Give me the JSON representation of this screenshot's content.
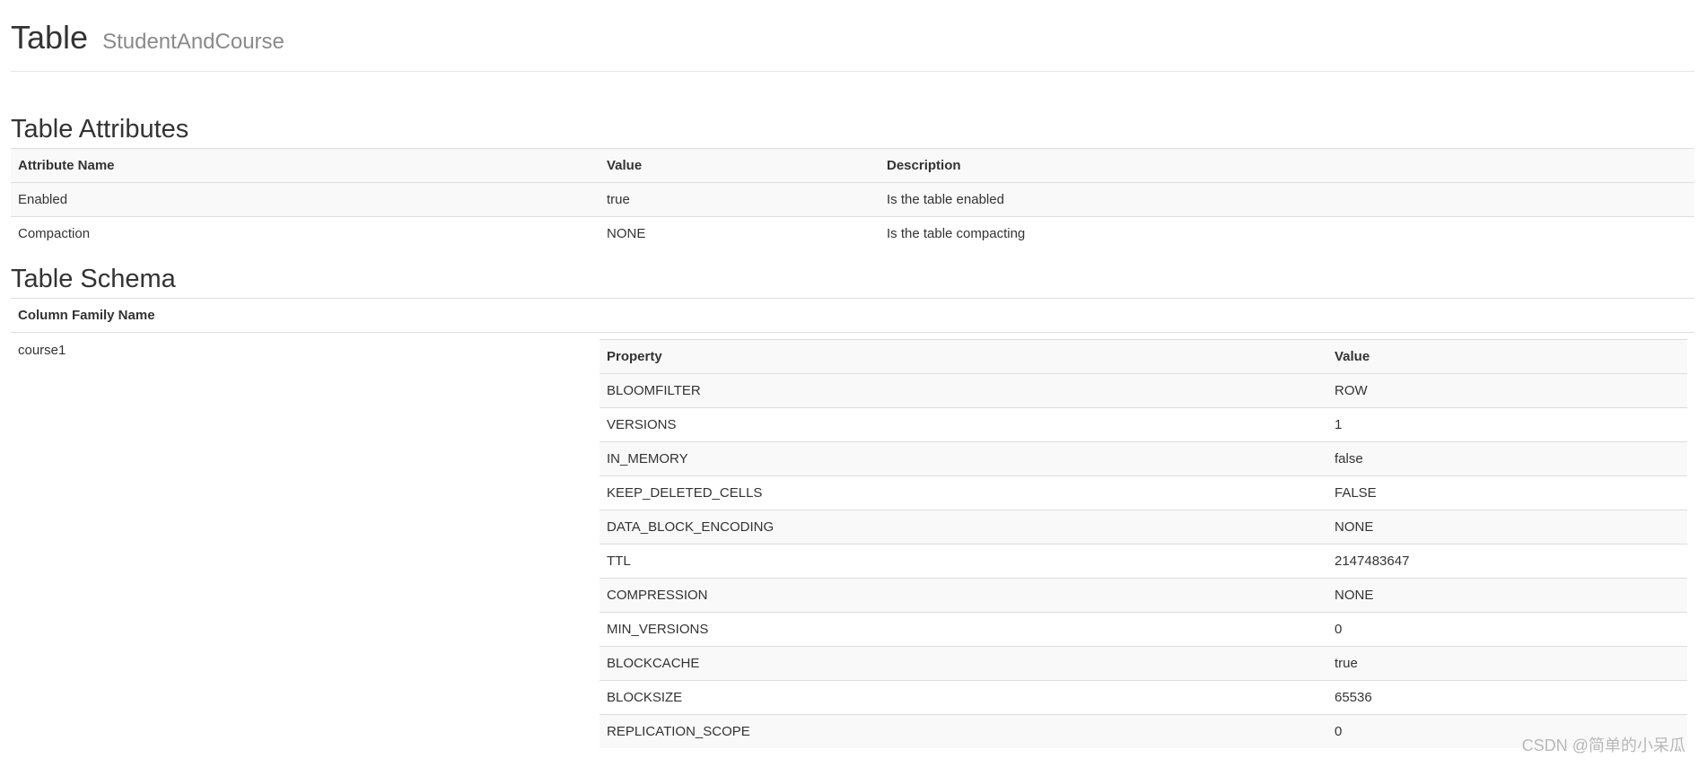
{
  "header": {
    "title": "Table",
    "subtitle": "StudentAndCourse"
  },
  "attributes": {
    "title": "Table Attributes",
    "columns": [
      "Attribute Name",
      "Value",
      "Description"
    ],
    "rows": [
      [
        "Enabled",
        "true",
        "Is the table enabled"
      ],
      [
        "Compaction",
        "NONE",
        "Is the table compacting"
      ]
    ]
  },
  "schema": {
    "title": "Table Schema",
    "column_header": "Column Family Name",
    "families": [
      {
        "name": "course1",
        "property_columns": [
          "Property",
          "Value"
        ],
        "properties": [
          [
            "BLOOMFILTER",
            "ROW"
          ],
          [
            "VERSIONS",
            "1"
          ],
          [
            "IN_MEMORY",
            "false"
          ],
          [
            "KEEP_DELETED_CELLS",
            "FALSE"
          ],
          [
            "DATA_BLOCK_ENCODING",
            "NONE"
          ],
          [
            "TTL",
            "2147483647"
          ],
          [
            "COMPRESSION",
            "NONE"
          ],
          [
            "MIN_VERSIONS",
            "0"
          ],
          [
            "BLOCKCACHE",
            "true"
          ],
          [
            "BLOCKSIZE",
            "65536"
          ],
          [
            "REPLICATION_SCOPE",
            "0"
          ]
        ]
      }
    ]
  },
  "watermark": "CSDN @简单的小呆瓜"
}
